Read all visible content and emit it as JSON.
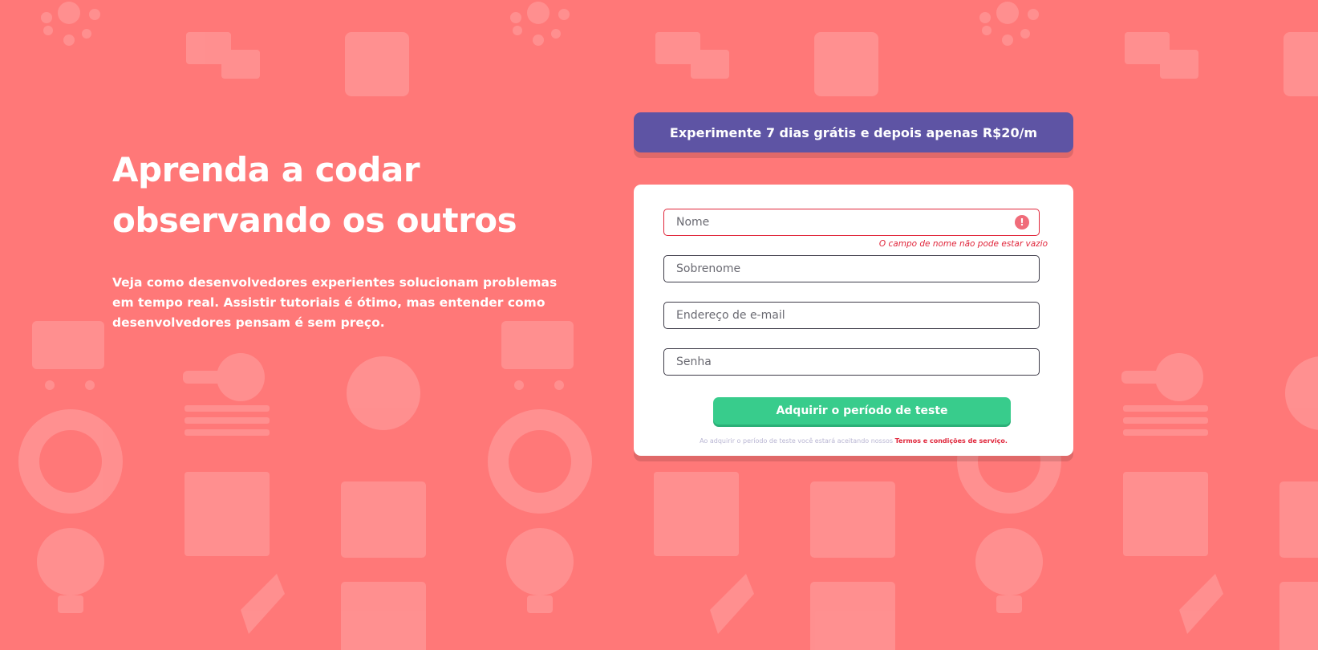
{
  "hero": {
    "title_line1": "Aprenda a codar",
    "title_line2": "observando os outros",
    "description": "Veja como desenvolvedores experientes solucionam problemas em tempo real. Assistir tutoriais é ótimo, mas entender como desenvolvedores pensam é sem preço."
  },
  "promo": {
    "text": "Experimente 7 dias grátis e depois apenas R$20/m"
  },
  "form": {
    "first_name": {
      "placeholder": "Nome",
      "value": ""
    },
    "first_name_error": "O campo de nome não pode estar vazio",
    "error_icon": "!",
    "last_name": {
      "placeholder": "Sobrenome",
      "value": ""
    },
    "email": {
      "placeholder": "Endereço de e-mail",
      "value": ""
    },
    "password": {
      "placeholder": "Senha",
      "value": ""
    },
    "submit_label": "Adquirir o período de teste",
    "terms_prefix": "Ao adquirir o período de teste você estará aceitando nossos",
    "terms_link": "Termos e condições de serviço."
  },
  "icons": {
    "error": "exclamation-circle-icon",
    "background": "developer-pattern-icons"
  },
  "colors": {
    "background": "#ff7878",
    "promo": "#5e54a4",
    "button": "#38cc8c",
    "error": "#e0253a"
  }
}
